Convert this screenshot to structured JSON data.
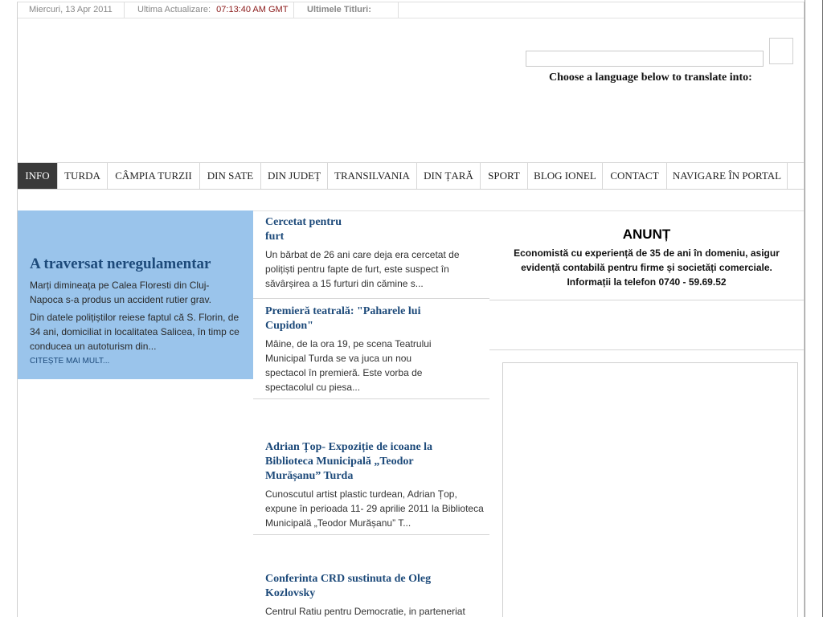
{
  "topbar": {
    "date": "Miercuri, 13 Apr 2011",
    "update_label": "Ultima Actualizare:",
    "update_time": "07:13:40 AM GMT",
    "headlines_label": "Ultimele Titluri:"
  },
  "translate": {
    "label": "Choose a language below to translate into:"
  },
  "nav": {
    "items": [
      {
        "label": "INFO",
        "active": true
      },
      {
        "label": "TURDA"
      },
      {
        "label": "CÂMPIA TURZII"
      },
      {
        "label": "DIN SATE"
      },
      {
        "label": "DIN JUDEȚ"
      },
      {
        "label": "TRANSILVANIA"
      },
      {
        "label": "DIN ȚARĂ"
      },
      {
        "label": "SPORT"
      },
      {
        "label": "BLOG IONEL"
      },
      {
        "label": "CONTACT"
      },
      {
        "label": "NAVIGARE ÎN PORTAL"
      }
    ]
  },
  "featured": {
    "title": "A traversat neregulamentar",
    "p1": "Marți dimineața pe Calea Floresti din Cluj-Napoca s-a produs un accident rutier grav.",
    "p2": "Din datele polițiștilor reiese faptul că S. Florin, de 34 ani, domiciliat in localitatea Salicea, în timp ce conducea un autoturism din...",
    "more": "CITEȘTE MAI MULT..."
  },
  "news": [
    {
      "title": "Cercetat pentru furt",
      "text": "Un bărbat de 26 ani care deja era cercetat de polițiști pentru fapte de furt, este suspect în săvârșirea a 15 furturi din cămine s..."
    },
    {
      "title": "Premieră teatrală: \"Paharele lui Cupidon\"",
      "text": "Mâine, de la ora 19, pe scena Teatrului Municipal Turda se va juca un nou spectacol în premieră. Este vorba de spectacolul cu piesa..."
    },
    {
      "title": "Adrian Țop- Expoziție de icoane la Biblioteca Municipală „Teodor Murășanu” Turda",
      "text": "Cunoscutul artist plastic turdean, Adrian Țop, expune în perioada 11- 29 aprilie 2011 la Biblioteca Municipală „Teodor Murășanu” T..."
    },
    {
      "title": "Conferinta CRD sustinuta de Oleg Kozlovsky",
      "text": "Centrul Ratiu pentru Democratie, in parteneriat"
    }
  ],
  "announce": {
    "title": "ANUNȚ",
    "text": "Economistă cu experiență de 35 de ani în domeniu, asigur evidență contabilă pentru firme și societăți comerciale. Informații la telefon 0740 - 59.69.52"
  }
}
